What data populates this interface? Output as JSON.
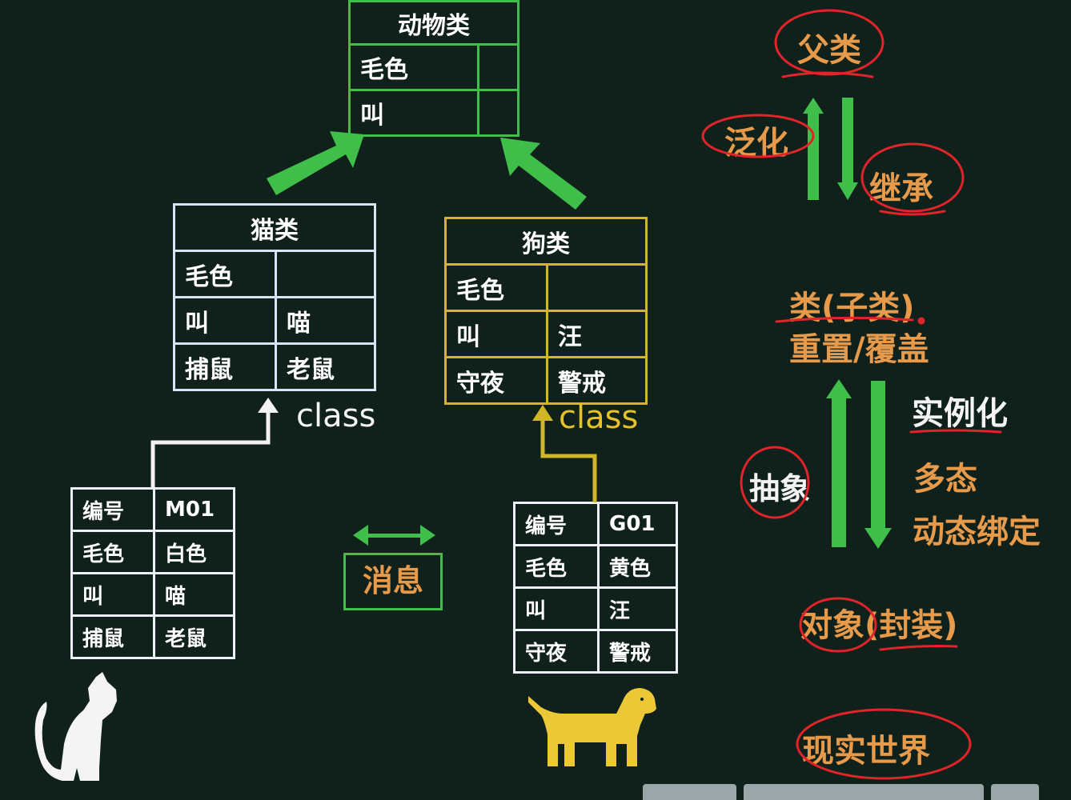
{
  "animal_class": {
    "title": "动物类",
    "rows": [
      [
        "毛色",
        ""
      ],
      [
        "叫",
        ""
      ]
    ]
  },
  "cat_class": {
    "title": "猫类",
    "rows": [
      [
        "毛色",
        ""
      ],
      [
        "叫",
        "喵"
      ],
      [
        "捕鼠",
        "老鼠"
      ]
    ],
    "class_label": "class"
  },
  "dog_class": {
    "title": "狗类",
    "rows": [
      [
        "毛色",
        ""
      ],
      [
        "叫",
        "汪"
      ],
      [
        "守夜",
        "警戒"
      ]
    ],
    "class_label": "class"
  },
  "cat_object": {
    "rows": [
      [
        "编号",
        "M01"
      ],
      [
        "毛色",
        "白色"
      ],
      [
        "叫",
        "喵"
      ],
      [
        "捕鼠",
        "老鼠"
      ]
    ]
  },
  "dog_object": {
    "rows": [
      [
        "编号",
        "G01"
      ],
      [
        "毛色",
        "黄色"
      ],
      [
        "叫",
        "汪"
      ],
      [
        "守夜",
        "警戒"
      ]
    ]
  },
  "message": {
    "label": "消息"
  },
  "concepts": {
    "parent": "父类",
    "generalize": "泛化",
    "inherit": "继承",
    "subclass": "类(子类)",
    "override": "重置/覆盖",
    "instantiate": "实例化",
    "abstract": "抽象",
    "polymorphism": "多态",
    "dynamic_binding": "动态绑定",
    "object": "对象(封装)",
    "real_world": "现实世界"
  },
  "colors": {
    "green": "#3fbf49",
    "yellow": "#d2b62a",
    "orange": "#e79a4a",
    "red_marks": "#e0242a",
    "background": "#10201a"
  }
}
